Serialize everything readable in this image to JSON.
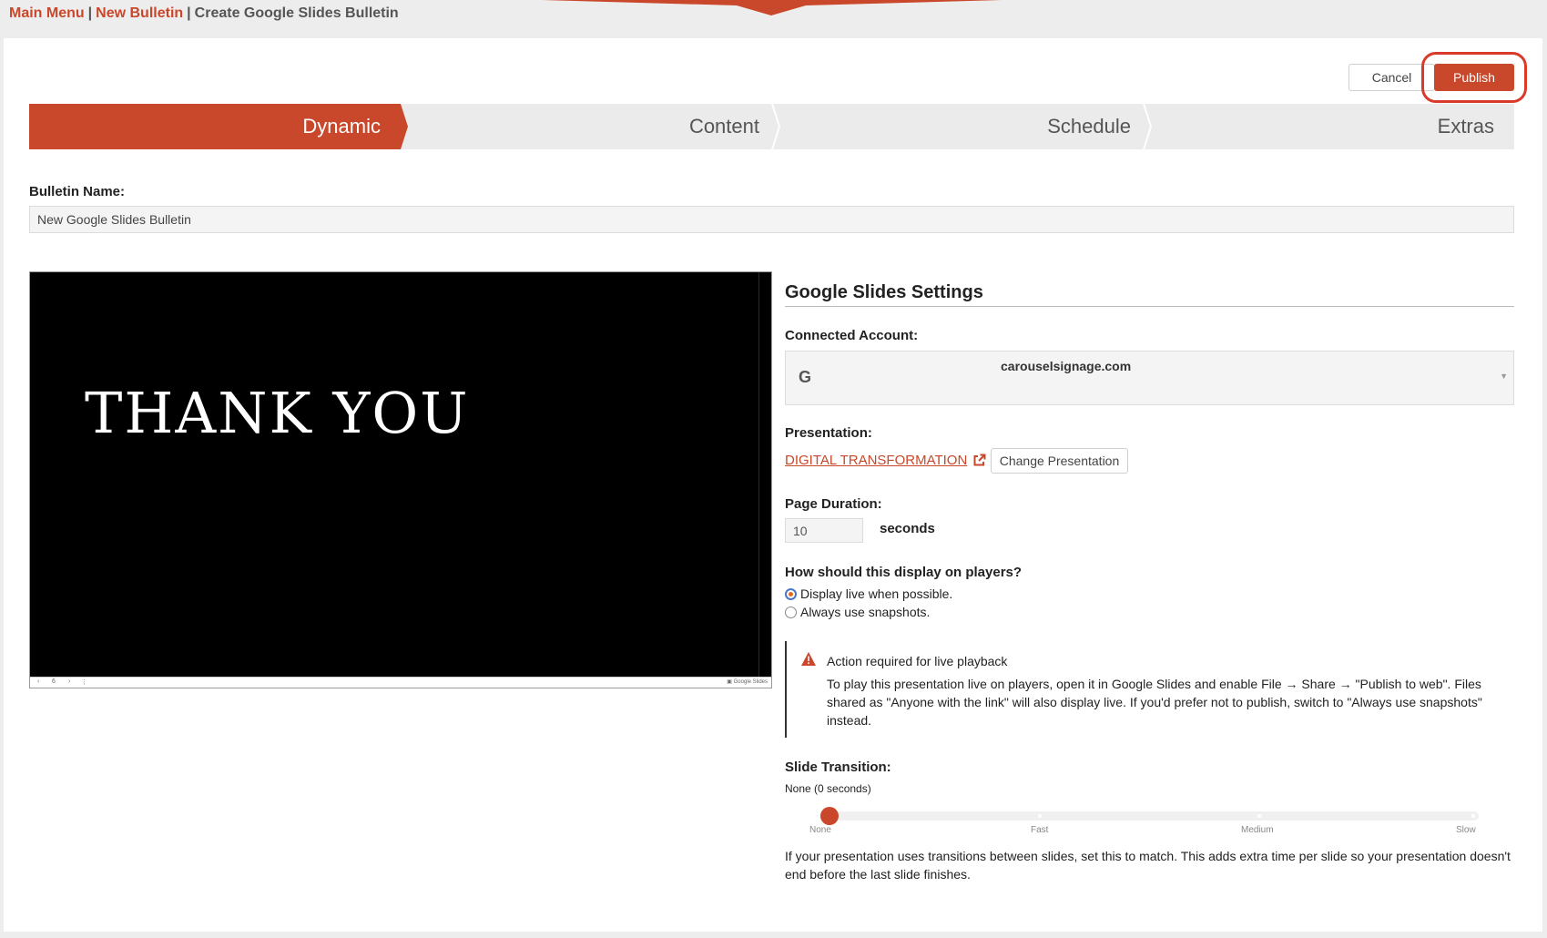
{
  "breadcrumb": {
    "main_menu": "Main Menu",
    "new_bulletin": "New Bulletin",
    "current": "Create Google Slides Bulletin",
    "separator": "|"
  },
  "actions": {
    "cancel": "Cancel",
    "publish": "Publish"
  },
  "steps": [
    {
      "label": "Dynamic",
      "active": true
    },
    {
      "label": "Content",
      "active": false
    },
    {
      "label": "Schedule",
      "active": false
    },
    {
      "label": "Extras",
      "active": false
    }
  ],
  "bulletin_name": {
    "label": "Bulletin Name:",
    "value": "New Google Slides Bulletin"
  },
  "preview": {
    "slide_text": "THANK YOU",
    "page_number": "6",
    "brand": "Google Slides"
  },
  "settings": {
    "title": "Google Slides Settings",
    "connected_account_label": "Connected Account:",
    "connected_account_value": "carouselsignage.com",
    "google_glyph": "G",
    "presentation_label": "Presentation:",
    "presentation_name": "DIGITAL TRANSFORMATION",
    "change_presentation": "Change Presentation",
    "page_duration_label": "Page Duration:",
    "page_duration_value": "10",
    "seconds_label": "seconds",
    "display_question": "How should this display on players?",
    "display_options": [
      {
        "label": "Display live when possible.",
        "selected": true
      },
      {
        "label": "Always use snapshots.",
        "selected": false
      }
    ],
    "alert_title": "Action required for live playback",
    "alert_body": "To play this presentation live on players, open it in Google Slides and enable File → Share → \"Publish to web\". Files shared as \"Anyone with the link\" will also display live. If you'd prefer not to publish, switch to \"Always use snapshots\" instead.",
    "slide_transition_label": "Slide Transition:",
    "slide_transition_value": "None (0 seconds)",
    "transition_ticks": [
      "None",
      "Fast",
      "Medium",
      "Slow"
    ],
    "transition_selected_index": 0,
    "transition_help": "If your presentation uses transitions between slides, set this to match. This adds extra time per slide so your presentation doesn't end before the last slide finishes."
  },
  "colors": {
    "accent": "#c9472a",
    "highlight_ring": "#d93a2a",
    "step_inactive": "#ebebeb"
  },
  "icons": {
    "external_link": "external-link-icon",
    "warning": "warning-icon",
    "dropdown": "chevron-down-icon",
    "google": "google-icon"
  }
}
